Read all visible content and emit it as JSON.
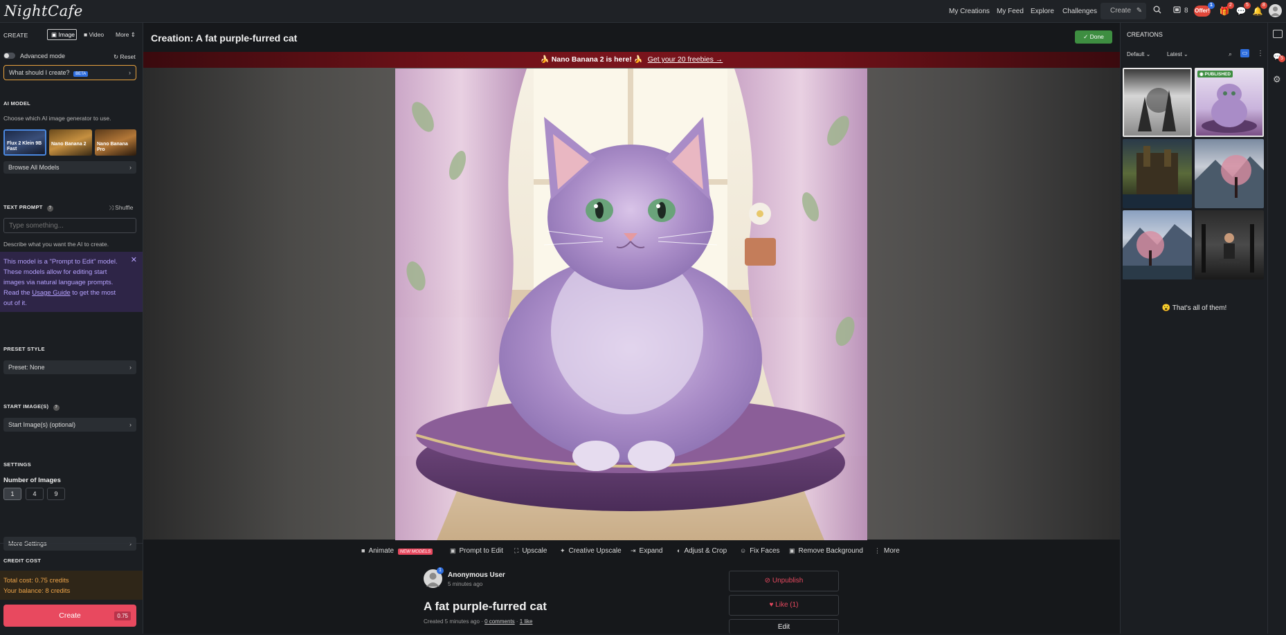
{
  "topbar": {
    "logo": "NightCafe",
    "nav": [
      "My Creations",
      "My Feed",
      "Explore",
      "Challenges"
    ],
    "create_label": "Create",
    "credits_count": "8",
    "offer_label": "Offer!",
    "offer_badge": "1",
    "badge_a": "2",
    "badge_b": "5",
    "badge_c": "8"
  },
  "left": {
    "create_label": "CREATE",
    "tab_image": "Image",
    "tab_video": "Video",
    "tab_more": "More",
    "advanced_mode": "Advanced mode",
    "reset": "Reset",
    "what_to_create": "What should I create?",
    "beta": "BETA",
    "ai_model_title": "AI MODEL",
    "ai_model_desc": "Choose which AI image generator to use.",
    "models": [
      "Flux 2 Klein 9B Fast",
      "Nano Banana 2",
      "Nano Banana Pro"
    ],
    "browse_models": "Browse All Models",
    "text_prompt_title": "TEXT PROMPT",
    "shuffle": "Shuffle",
    "prompt_placeholder": "Type something...",
    "prompt_desc": "Describe what you want the AI to create.",
    "info_text_1": "This model is a \"Prompt to Edit\" model. These models allow for editing start images via natural language prompts. Read the",
    "info_link": "Usage Guide",
    "info_text_2": "to get the most out of it.",
    "preset_title": "PRESET STYLE",
    "preset_value": "Preset: None",
    "start_images_title": "START IMAGE(S)",
    "start_images_value": "Start Image(s) (optional)",
    "settings_title": "SETTINGS",
    "num_images_label": "Number of Images",
    "num_options": [
      "1",
      "4",
      "9"
    ],
    "more_settings": "More Settings",
    "credit_cost_title": "CREDIT COST",
    "total_cost": "Total cost: 0.75 credits",
    "balance": "Your balance: 8 credits",
    "create_button": "Create",
    "create_cost": "0.75"
  },
  "main": {
    "title": "Creation: A fat purple-furred cat",
    "done": "Done",
    "banner_text": "🍌 Nano Banana 2 is here! 🍌",
    "banner_link": "Get your 20 freebies →",
    "tools": [
      "Animate",
      "Prompt to Edit",
      "Upscale",
      "Creative Upscale",
      "Expand",
      "Adjust & Crop",
      "Fix Faces",
      "Remove Background",
      "More"
    ],
    "new_models_badge": "NEW MODELS",
    "user_name": "Anonymous User",
    "user_badge": "1",
    "posted_time": "5 minutes ago",
    "creation_title": "A fat purple-furred cat",
    "created_meta": "Created 5 minutes ago",
    "comments": "0 comments",
    "likes": "1 like",
    "unpublish": "Unpublish",
    "like_button": "Like (1)",
    "edit_button": "Edit"
  },
  "right": {
    "title": "CREATIONS",
    "sort_default": "Default",
    "sort_latest": "Latest",
    "published_badge": "PUBLISHED",
    "end_text": "😮 That's all of them!",
    "side_badge": "5"
  },
  "colors": {
    "accent_red": "#e8495f",
    "done_green": "#3e8e41",
    "info_purple": "#2e2547",
    "credit_orange": "#f0a64a"
  }
}
